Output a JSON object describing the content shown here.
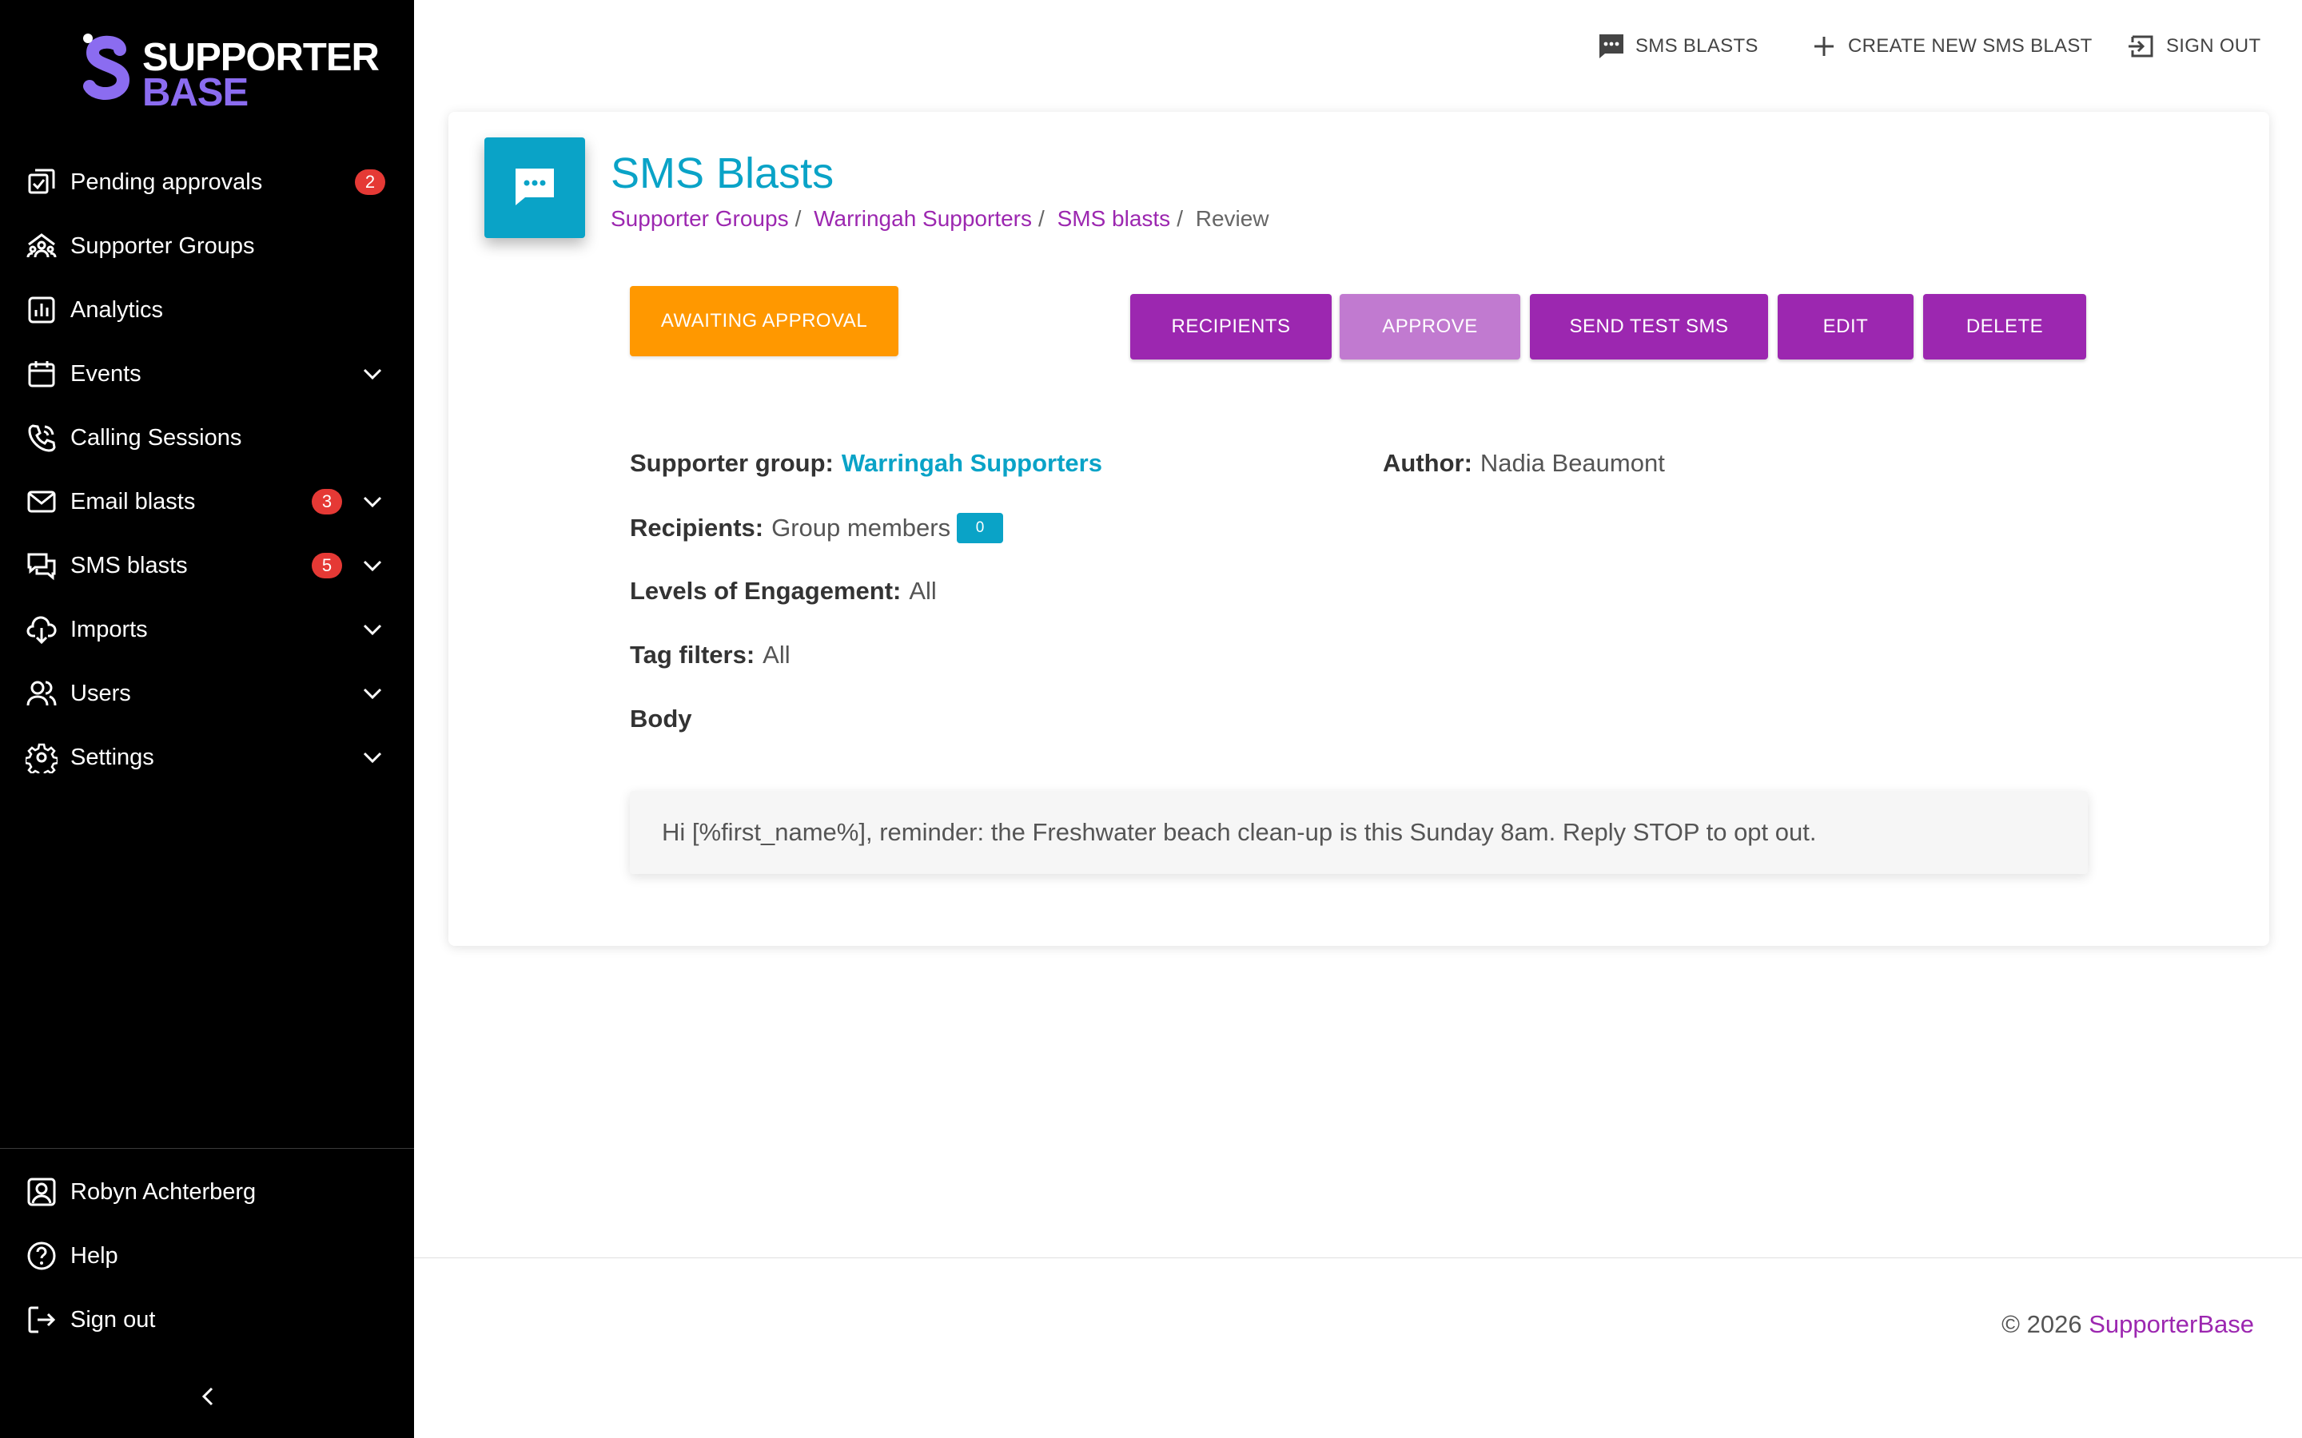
{
  "brand": {
    "line1": "SUPPORTER",
    "line2": "BASE"
  },
  "sidebar": {
    "items": [
      {
        "label": "Pending approvals",
        "icon": "approvals-icon",
        "badge": "2",
        "chevron": false
      },
      {
        "label": "Supporter Groups",
        "icon": "groups-icon",
        "badge": null,
        "chevron": false
      },
      {
        "label": "Analytics",
        "icon": "analytics-icon",
        "badge": null,
        "chevron": false
      },
      {
        "label": "Events",
        "icon": "calendar-icon",
        "badge": null,
        "chevron": true
      },
      {
        "label": "Calling Sessions",
        "icon": "phone-icon",
        "badge": null,
        "chevron": false
      },
      {
        "label": "Email blasts",
        "icon": "mail-icon",
        "badge": "3",
        "chevron": true
      },
      {
        "label": "SMS blasts",
        "icon": "chat-icon",
        "badge": "5",
        "chevron": true
      },
      {
        "label": "Imports",
        "icon": "import-icon",
        "badge": null,
        "chevron": true
      },
      {
        "label": "Users",
        "icon": "users-icon",
        "badge": null,
        "chevron": true
      },
      {
        "label": "Settings",
        "icon": "gear-icon",
        "badge": null,
        "chevron": true
      }
    ],
    "bottom": [
      {
        "label": "Robyn Achterberg",
        "icon": "account-icon"
      },
      {
        "label": "Help",
        "icon": "help-icon"
      },
      {
        "label": "Sign out",
        "icon": "logout-icon"
      }
    ]
  },
  "topbar": {
    "sms_blasts": "SMS BLASTS",
    "create_new": "CREATE NEW SMS BLAST",
    "sign_out": "SIGN OUT"
  },
  "page": {
    "title": "SMS Blasts",
    "breadcrumb": [
      "Supporter Groups",
      "Warringah Supporters",
      "SMS blasts"
    ],
    "breadcrumb_current": "Review"
  },
  "status": "AWAITING APPROVAL",
  "actions": {
    "recipients": "RECIPIENTS",
    "approve": "APPROVE",
    "send_test": "SEND TEST SMS",
    "edit": "EDIT",
    "delete": "DELETE"
  },
  "details": {
    "supporter_group_label": "Supporter group:",
    "supporter_group_value": "Warringah Supporters",
    "author_label": "Author:",
    "author_value": "Nadia Beaumont",
    "recipients_label": "Recipients:",
    "recipients_value": "Group members",
    "recipients_count": "0",
    "engagement_label": "Levels of Engagement:",
    "engagement_value": "All",
    "tags_label": "Tag filters:",
    "tags_value": "All",
    "body_label": "Body",
    "body_text": "Hi [%first_name%], reminder: the Freshwater beach clean-up is this Sunday 8am. Reply STOP to opt out."
  },
  "footer": {
    "copyright": "© 2026",
    "brand": "SupporterBase"
  },
  "colors": {
    "accent": "#9c27b0",
    "primary": "#0aa3c7",
    "status": "#ff9800",
    "badge": "#e53935"
  }
}
